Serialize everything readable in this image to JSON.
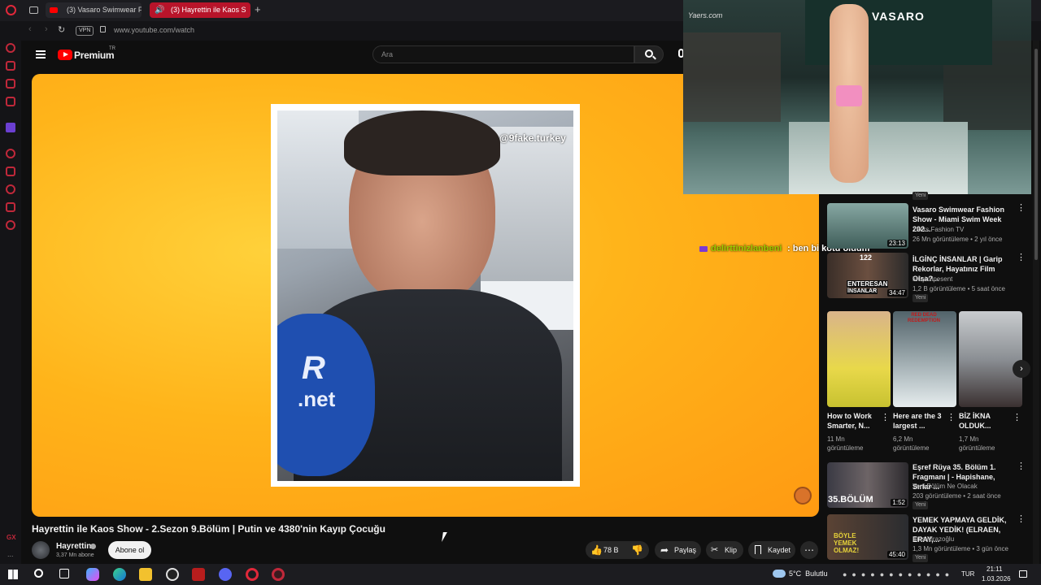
{
  "browser": {
    "tabs": [
      {
        "label": "(3) Vasaro Swimwear Fashi",
        "active": false
      },
      {
        "label": "(3) Hayrettin ile Kaos S",
        "active": true
      }
    ],
    "new_tab_label": "+",
    "vpn_label": "VPN",
    "url": "www.youtube.com/watch"
  },
  "youtube": {
    "logo_label": "Premium",
    "logo_superscript": "TR",
    "search_placeholder": "Ara"
  },
  "video": {
    "watermark": "@9fake.turkey",
    "mic_text_1": "R",
    "mic_text_2": ".net",
    "title": "Hayrettin ile Kaos Show - 2.Sezon 9.Bölüm | Putin ve 4380'nin Kayıp Çocuğu",
    "channel": "Hayrettin",
    "subscribers": "3,37 Mn abone",
    "subscribe_label": "Abone ol",
    "likes": "78 B",
    "share_label": "Paylaş",
    "clip_label": "Klip",
    "save_label": "Kaydet"
  },
  "chat_overlay": {
    "user": "delirttinizlanbeni",
    "message": ": ben bi kötü oldum"
  },
  "pip": {
    "watermark": "Yaers.com",
    "brand": "VASARO"
  },
  "sidebar": {
    "partial_top_badge": "Yeni",
    "items": [
      {
        "title": "Vasaro Swimwear Fashion Show - Miami Swim Week 202...",
        "channel": "Yaers Fashion TV",
        "meta": "26 Mn görüntüleme • 2 yıl önce",
        "duration": "23:13",
        "badge": ""
      },
      {
        "title": "İLGİNÇ İNSANLAR | Garip Rekorlar, Hayatınız Film Olsa?...",
        "channel": "Müşkülpesent",
        "meta": "1,2 B görüntüleme • 5 saat önce",
        "duration": "34:47",
        "badge": "Yeni",
        "thumb_text_1": "ENTERESAN",
        "thumb_text_2": "İNSANLAR",
        "thumb_num": "122"
      },
      {
        "title": "Eşref Rüya 35. Bölüm 1. Fragmanı | - Hapishane, Sırlar ...",
        "channel": "Yeni Bölüm Ne Olacak",
        "meta": "203 görüntüleme • 2 saat önce",
        "duration": "1:52",
        "badge": "Yeni",
        "thumb_text_1": "35.BÖLÜM"
      },
      {
        "title": "YEMEK YAPMAYA GELDİK, DAYAK YEDİK! (ELRAEN, ERAY,...",
        "channel": "Enis Kirazoğlu",
        "meta": "1,3 Mn görüntüleme • 3 gün önce",
        "duration": "45:40",
        "badge": "Yeni",
        "thumb_text_1": "BÖYLE YEMEK OLMAZ!"
      }
    ],
    "shorts": [
      {
        "title": "How to Work Smarter, N...",
        "views": "11 Mn",
        "views_label": "görüntüleme"
      },
      {
        "title": "Here are the 3 largest ...",
        "views": "6,2 Mn",
        "views_label": "görüntüleme",
        "thumb_text": "RED DEAD REDEMPTION"
      },
      {
        "title": "BİZ İKNA OLDUK...",
        "views": "1,7 Mn",
        "views_label": "görüntüleme"
      }
    ]
  },
  "taskbar": {
    "weather": "5°C  Bulutlu",
    "lang": "TUR",
    "time": "21:11",
    "date": "1.03.2026"
  },
  "colors": {
    "yt_red": "#ff0000",
    "opera_red": "#c0283a",
    "orange_bg": "#ffb41a",
    "chat_user": "#9ccc00"
  }
}
